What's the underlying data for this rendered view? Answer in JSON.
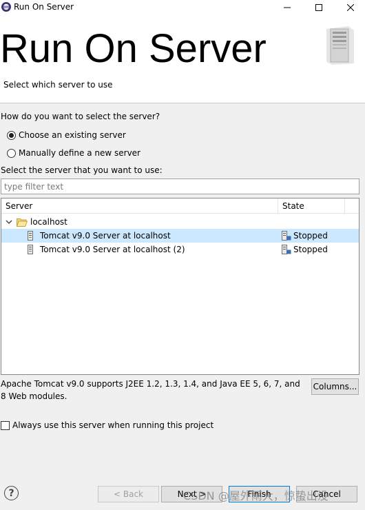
{
  "window": {
    "title": "Run On Server",
    "app_icon": "eclipse-icon",
    "controls": [
      "minimize-icon",
      "maximize-icon",
      "close-icon"
    ]
  },
  "header": {
    "title": "Run On Server",
    "subtitle": "Select which server to use",
    "graphic": "server-tower-icon"
  },
  "selection": {
    "question": "How do you want to select the server?",
    "options": [
      {
        "label": "Choose an existing server",
        "selected": true
      },
      {
        "label": "Manually define a new server",
        "selected": false
      }
    ]
  },
  "server_list": {
    "prompt": "Select the server that you want to use:",
    "filter_placeholder": "type filter text",
    "filter_value": "",
    "columns": [
      "Server",
      "State"
    ],
    "group": {
      "label": "localhost",
      "expanded": true,
      "icon": "folder-open-icon"
    },
    "rows": [
      {
        "name": "Tomcat v9.0 Server at localhost",
        "state": "Stopped",
        "selected": true
      },
      {
        "name": "Tomcat v9.0 Server at localhost (2)",
        "state": "Stopped",
        "selected": false
      }
    ]
  },
  "description": "Apache Tomcat v9.0 supports J2EE 1.2, 1.3, 1.4, and Java EE 5, 6, 7, and 8 Web modules.",
  "columns_button": "Columns...",
  "always_use": {
    "label": "Always use this server when running this project",
    "checked": false
  },
  "footer": {
    "help_icon": "help-icon",
    "back": "< Back",
    "next": "Next >",
    "finish": "Finish",
    "cancel": "Cancel"
  },
  "watermark": "CSDN @屋外雨大，惊蛰出没",
  "colors": {
    "selection": "#cce8ff",
    "default_button_border": "#0078d7"
  }
}
